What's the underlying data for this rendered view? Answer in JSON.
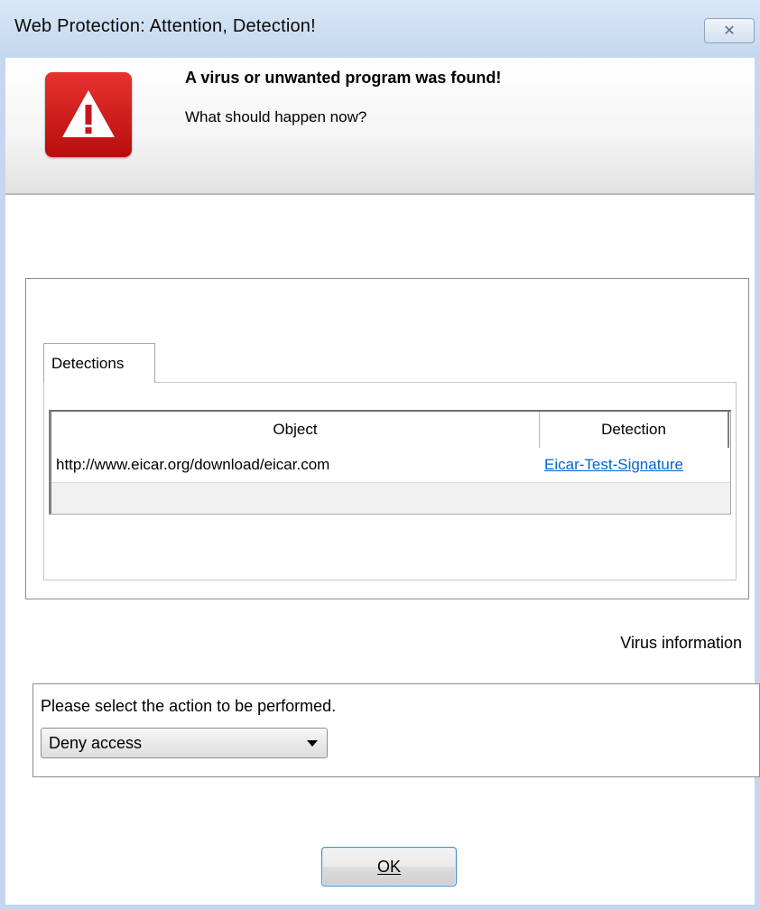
{
  "window": {
    "title": "Web Protection: Attention, Detection!",
    "close_glyph": "✕"
  },
  "header": {
    "icon": "alert-warning-icon",
    "title": "A virus or unwanted program was found!",
    "subtitle": "What should happen now?"
  },
  "detections": {
    "tab_label": "Detections",
    "columns": [
      "Object",
      "Detection"
    ],
    "rows": [
      {
        "object": "http://www.eicar.org/download/eicar.com",
        "detection": "Eicar-Test-Signature"
      }
    ]
  },
  "virus_info_label": "Virus information",
  "action": {
    "label": "Please select the action to be performed.",
    "selected": "Deny access"
  },
  "ok_label": "OK",
  "colors": {
    "alert_red": "#d0201e",
    "link_blue": "#0066cc",
    "titlebar": "#c4d7ee"
  }
}
